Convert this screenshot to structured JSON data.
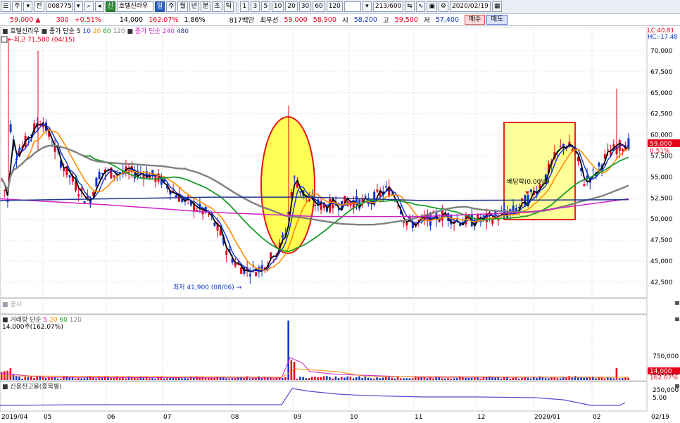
{
  "toolbar": {
    "type_label": "주",
    "market_label": "전",
    "code": "008775",
    "badge": "신",
    "name": "호텔신라우",
    "periods": [
      "일",
      "주",
      "월",
      "년",
      "분",
      "초",
      "틱"
    ],
    "intervals": [
      "1",
      "3",
      "5",
      "10",
      "20",
      "30",
      "60",
      "120"
    ],
    "count": "213",
    "total": "/600",
    "date": "2020/02/19"
  },
  "quote": {
    "price": "59,000",
    "change": "300",
    "change_pct": "+0.51%",
    "volume": "14,000",
    "volume_ratio": "162.07%",
    "turnover_pct": "1.86%",
    "amount": "817백만",
    "best_sell_label": "최우선",
    "best_sell": "59,000",
    "best_buy": "58,900",
    "open_label": "시",
    "open": "58,200",
    "high_label": "고",
    "high": "59,500",
    "low_label": "저",
    "low": "57,400",
    "buy_label": "매수",
    "sell_label": "매도"
  },
  "price_pane": {
    "legend_name": "호텔신라우",
    "legend_ma_label": "종가 단순",
    "legend_ma": [
      "5",
      "10",
      "20",
      "60",
      "120"
    ],
    "legend_ma2_label": "종가 단순",
    "legend_ma2": [
      "240",
      "480"
    ],
    "high_note": "최고 71,500 (04/15)",
    "low_note": "최저 41,900 (08/06)",
    "dividend_note": "배당락(0.00%)",
    "lc": "LC:40.81",
    "hc": "HC:-17.48",
    "y_ticks": [
      "70,000",
      "67,500",
      "65,000",
      "62,500",
      "60,000",
      "57,500",
      "55,000",
      "52,500",
      "50,000",
      "47,500",
      "45,000",
      "42,500"
    ],
    "last_price": "59,000",
    "last_pct": "0.51%",
    "colors": {
      "up": "#e4001b",
      "down": "#1034c8",
      "ma5": "#000000",
      "ma10": "#0a2fd0",
      "ma20": "#ff8c00",
      "ma60": "#1a9c2a",
      "ma120": "#7f7f7f",
      "ma240": "#d020c8",
      "ma480": "#203890"
    }
  },
  "notice_pane": {
    "label": "공시"
  },
  "volume_pane": {
    "legend_label": "거래량 단순",
    "legend_ma": [
      "5",
      "20",
      "60",
      "120"
    ],
    "legend_value": "14,000주(162.07%)",
    "y_ticks": [
      "750,000",
      "500,000",
      "250,000"
    ],
    "last_value": "14,000",
    "last_pct": "162.07%"
  },
  "credit_pane": {
    "legend_label": "신용잔고율(종목별)",
    "y_ticks": [
      "5.00"
    ]
  },
  "x_axis": {
    "labels": [
      "2019/04",
      "05",
      "06",
      "07",
      "08",
      "09",
      "10",
      "11",
      "12",
      "2020/01",
      "02"
    ],
    "right_label": "02/19"
  }
}
